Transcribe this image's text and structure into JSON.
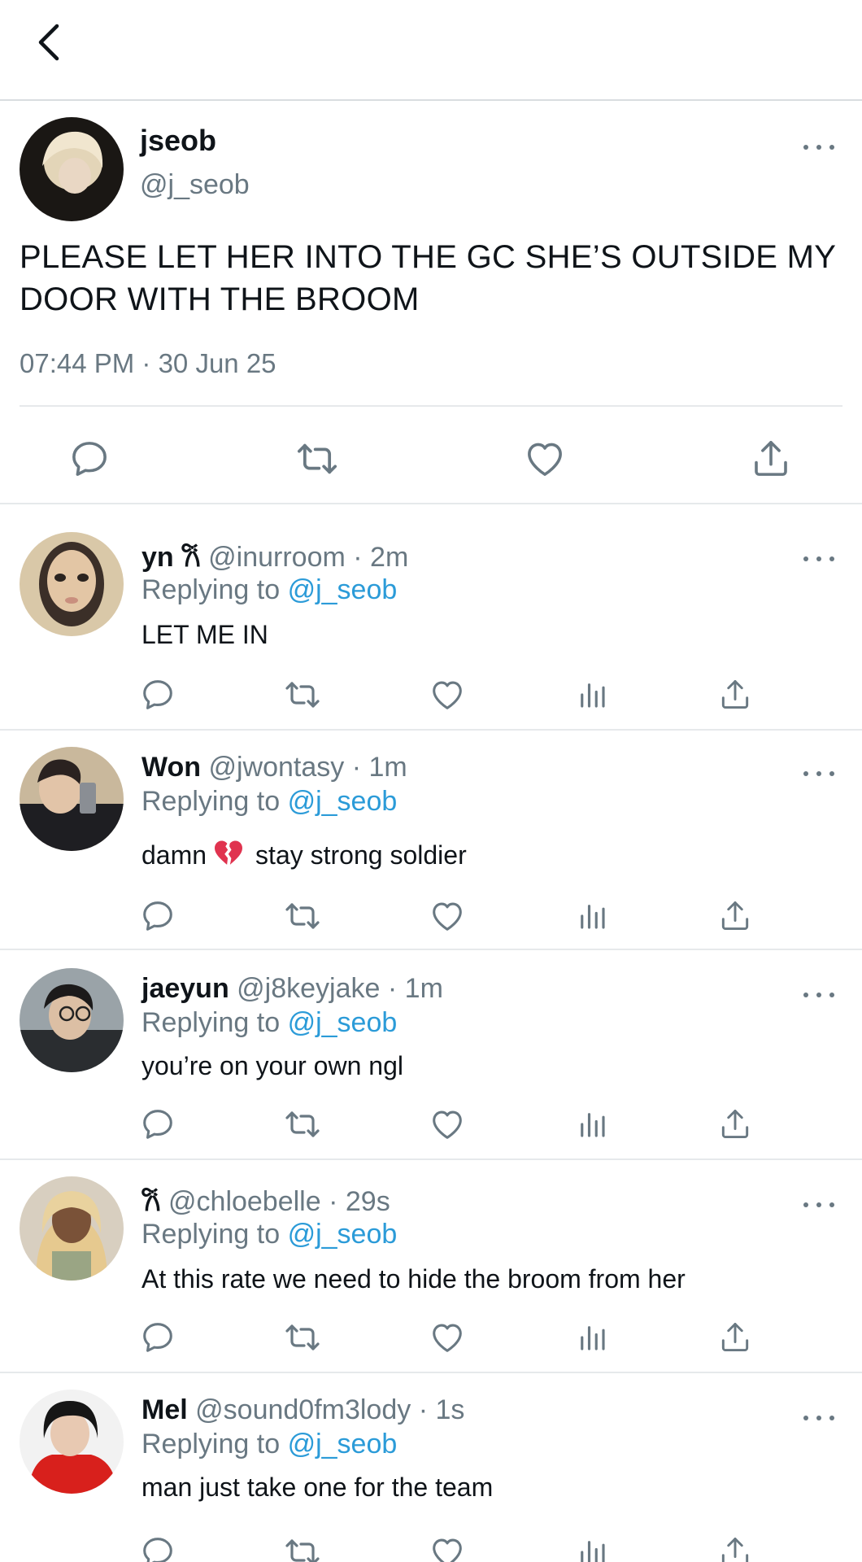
{
  "main_tweet": {
    "name": "jseob",
    "handle": "@j_seob",
    "text": "PLEASE LET HER INTO THE GC SHE’S OUTSIDE MY DOOR WITH THE BROOM",
    "timestamp": "07:44 PM · 30 Jun 25"
  },
  "colors": {
    "text": "#0f1419",
    "secondary": "#697882",
    "mention": "#2b9bd8",
    "divider": "#e6e9eb"
  },
  "icons": {
    "back": "chevron-left-icon",
    "more": "more-dots-icon",
    "reply": "comment-bubble-icon",
    "retweet": "retweet-icon",
    "like": "heart-icon",
    "analytics": "analytics-bars-icon",
    "share": "share-upload-icon"
  },
  "replies": [
    {
      "name": "yn 𐙚",
      "handle": "@inurroom",
      "time": "· 2m",
      "replying_label": "Replying to",
      "mention": "@j_seob",
      "text": "LET ME IN"
    },
    {
      "name": "Won",
      "handle": "@jwontasy",
      "time": "· 1m",
      "replying_label": "Replying to",
      "mention": "@j_seob",
      "text_before": "damn",
      "emoji": "broken-heart",
      "text_after": "stay strong soldier"
    },
    {
      "name": "jaeyun",
      "handle": "@j8keyjake",
      "time": "· 1m",
      "replying_label": "Replying to",
      "mention": "@j_seob",
      "text": "you’re on your own ngl"
    },
    {
      "name": "𐙚",
      "handle": "@chloebelle",
      "time": "· 29s",
      "replying_label": "Replying to",
      "mention": "@j_seob",
      "text": "At this rate we need to hide the broom from her"
    },
    {
      "name": "Mel",
      "handle": "@sound0fm3lody",
      "time": "· 1s",
      "replying_label": "Replying to",
      "mention": "@j_seob",
      "text": "man just take one for the team"
    }
  ]
}
